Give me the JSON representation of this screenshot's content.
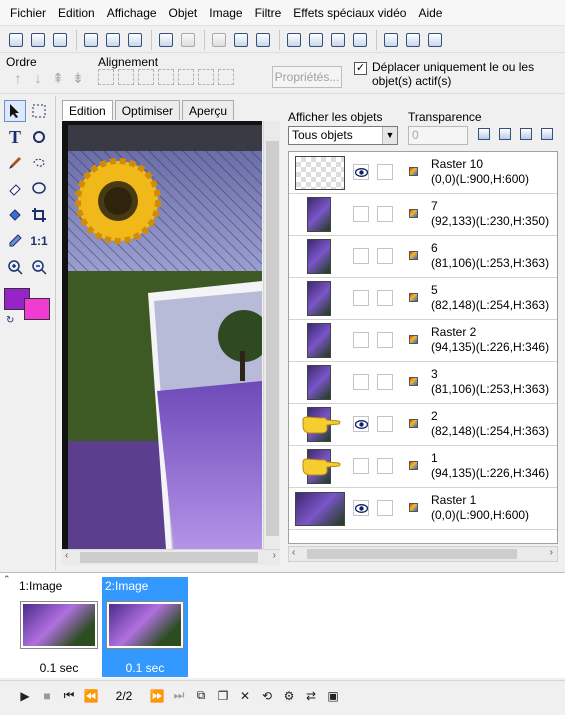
{
  "menu": [
    "Fichier",
    "Edition",
    "Affichage",
    "Objet",
    "Image",
    "Filtre",
    "Effets spéciaux vidéo",
    "Aide"
  ],
  "toolbar": {
    "icons": [
      "new-icon",
      "open-icon",
      "save-icon",
      "import-icon",
      "export-icon",
      "preview-icon",
      "undo-icon",
      "redo-icon",
      "cut-icon",
      "copy-icon",
      "paste-icon",
      "crop-icon",
      "resize-icon",
      "rotate-icon",
      "flip-icon",
      "web-icon",
      "settings-icon",
      "help-icon"
    ]
  },
  "align_bar": {
    "order_label": "Ordre",
    "alignment_label": "Alignement",
    "properties_button": "Propriétés...",
    "move_checkbox_label": "Déplacer uniquement le ou les objet(s) actif(s)",
    "move_checkbox_checked": true
  },
  "tools": [
    "select-arrow-icon",
    "select-rect-icon",
    "text-icon",
    "rotate-tool-icon",
    "brush-icon",
    "lasso-icon",
    "eraser-icon",
    "zoom-lens-icon",
    "fill-bucket-icon",
    "crop-tool-icon",
    "eyedropper-icon",
    "one-to-one-icon",
    "zoom-in-icon",
    "zoom-out-icon"
  ],
  "tools_text": {
    "text_tool": "T",
    "one_to_one": "1:1"
  },
  "colors": {
    "foreground": "#9624c8",
    "background": "#f03cd2"
  },
  "tabs": [
    "Edition",
    "Optimiser",
    "Aperçu"
  ],
  "active_tab": 0,
  "layers_panel": {
    "show_objects_label": "Afficher les objets",
    "show_objects_value": "Tous objets",
    "transparency_label": "Transparence",
    "transparency_value": "0",
    "layers": [
      {
        "name": "Raster 10",
        "dims": "(0,0)(L:900,H:600)",
        "visible": true,
        "wide": true,
        "hand": false
      },
      {
        "name": "7",
        "dims": "(92,133)(L:230,H:350)",
        "visible": false,
        "wide": false,
        "hand": false
      },
      {
        "name": "6",
        "dims": "(81,106)(L:253,H:363)",
        "visible": false,
        "wide": false,
        "hand": false
      },
      {
        "name": "5",
        "dims": "(82,148)(L:254,H:363)",
        "visible": false,
        "wide": false,
        "hand": false
      },
      {
        "name": "Raster 2",
        "dims": "(94,135)(L:226,H:346)",
        "visible": false,
        "wide": false,
        "hand": false
      },
      {
        "name": "3",
        "dims": "(81,106)(L:253,H:363)",
        "visible": false,
        "wide": false,
        "hand": false
      },
      {
        "name": "2",
        "dims": "(82,148)(L:254,H:363)",
        "visible": true,
        "wide": false,
        "hand": true
      },
      {
        "name": "1",
        "dims": "(94,135)(L:226,H:346)",
        "visible": false,
        "wide": false,
        "hand": true
      },
      {
        "name": "Raster 1",
        "dims": "(0,0)(L:900,H:600)",
        "visible": true,
        "wide": true,
        "hand": false
      }
    ]
  },
  "frames": [
    {
      "label": "1:Image",
      "delay": "0.1 sec",
      "selected": false
    },
    {
      "label": "2:Image",
      "delay": "0.1 sec",
      "selected": true
    }
  ],
  "playback": {
    "counter": "2/2"
  }
}
